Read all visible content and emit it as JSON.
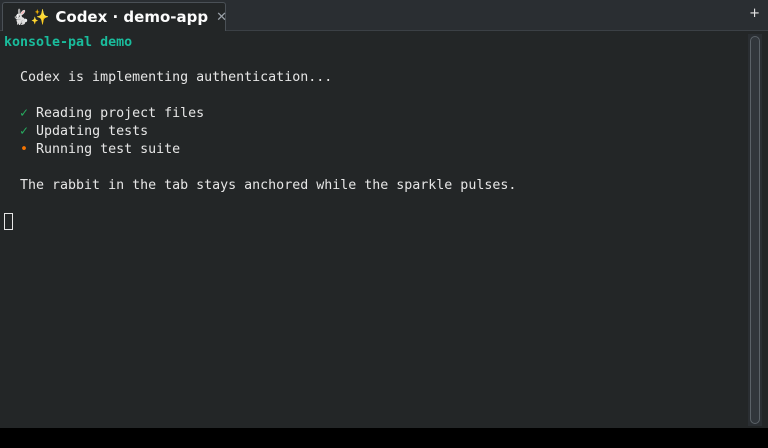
{
  "tab": {
    "icons": [
      "rabbit-icon",
      "sparkle-icon"
    ],
    "rabbit_glyph": "🐇",
    "sparkle_glyph": "✨",
    "title": "Codex · demo-app",
    "close_glyph": "✕"
  },
  "tabbar": {
    "new_tab_glyph": "+"
  },
  "terminal": {
    "title_line": "konsole-pal demo",
    "status_line": "  Codex is implementing authentication...",
    "tasks": [
      {
        "marker": "✓",
        "text": " Reading project files",
        "state": "done"
      },
      {
        "marker": "✓",
        "text": " Updating tests",
        "state": "done"
      },
      {
        "marker": "•",
        "text": " Running test suite",
        "state": "running"
      }
    ],
    "note_line": "  The rabbit in the tab stays anchored while the sparkle pulses."
  },
  "colors": {
    "background": "#232627",
    "accent": "#1abc9c",
    "done": "#27ae60",
    "running": "#f67400",
    "text": "#e6e6e6"
  }
}
